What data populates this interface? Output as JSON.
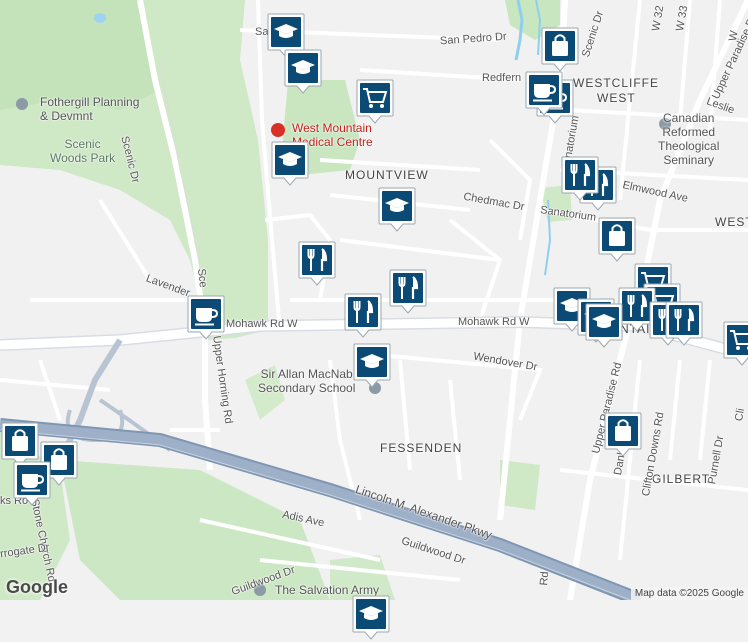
{
  "map": {
    "attribution": "Map data ©2025 Google",
    "logo": "Google",
    "neighbourhoods": [
      {
        "id": "mountview",
        "text": "MOUNTVIEW"
      },
      {
        "id": "westcliffe-west-1",
        "text": "WESTCLIFFE"
      },
      {
        "id": "westcliffe-west-2",
        "text": "WEST"
      },
      {
        "id": "fessenden",
        "text": "FESSENDEN"
      },
      {
        "id": "gilbert",
        "text": "GILBERT"
      },
      {
        "id": "west-edge",
        "text": "WEST"
      },
      {
        "id": "mountain-edge",
        "text": "OUNTAI"
      }
    ],
    "roads": [
      {
        "id": "mohawk-w",
        "text": "Mohawk Rd W"
      },
      {
        "id": "mohawk-e",
        "text": "Mohawk Rd W"
      },
      {
        "id": "scenic-dr",
        "text": "Scenic Dr"
      },
      {
        "id": "scenic-dr-2",
        "text": "Sce"
      },
      {
        "id": "scenic-dr-ne",
        "text": "Scenic Dr"
      },
      {
        "id": "san-pedro",
        "text": "San Pedro Dr"
      },
      {
        "id": "san-top",
        "text": "Sa"
      },
      {
        "id": "redfern",
        "text": "Redfern"
      },
      {
        "id": "chedmac",
        "text": "Chedmac Dr"
      },
      {
        "id": "sanatorium",
        "text": "Sanatorium"
      },
      {
        "id": "sanatorium-2",
        "text": "Sanatorium"
      },
      {
        "id": "elmwood",
        "text": "Elmwood Ave"
      },
      {
        "id": "wendover",
        "text": "Wendover Dr"
      },
      {
        "id": "upper-paradise",
        "text": "Upper Paradise Rd"
      },
      {
        "id": "upper-paradise-ne",
        "text": "Upper Paradise Rd"
      },
      {
        "id": "upper-horning",
        "text": "Upper Horning Rd"
      },
      {
        "id": "lavender",
        "text": "Lavender"
      },
      {
        "id": "lincoln",
        "text": "Lincoln M. Alexander Pkwy"
      },
      {
        "id": "adis",
        "text": "Adis Ave"
      },
      {
        "id": "guildwood",
        "text": "Guildwood Dr"
      },
      {
        "id": "guildwood-2",
        "text": "Guildwood Dr"
      },
      {
        "id": "clifton-downs",
        "text": "Clifton Downs Rd"
      },
      {
        "id": "purnell",
        "text": "Purnell Dr"
      },
      {
        "id": "danl",
        "text": "Danl"
      },
      {
        "id": "w32",
        "text": "W 32"
      },
      {
        "id": "w33",
        "text": "W 33"
      },
      {
        "id": "leslie",
        "text": "Leslie"
      },
      {
        "id": "stone-church",
        "text": "Stone Church Rd"
      },
      {
        "id": "rogate",
        "text": "rrogate Dr"
      },
      {
        "id": "ks-ro",
        "text": "ks Ro"
      },
      {
        "id": "rd-bottom",
        "text": "Rd"
      },
      {
        "id": "cli",
        "text": "Cli"
      },
      {
        "id": "w-edge",
        "text": "W"
      }
    ],
    "places": [
      {
        "id": "fothergill",
        "text": "Fothergill Planning\n& Devmnt"
      },
      {
        "id": "scenic-woods",
        "text": "Scenic\nWoods Park"
      },
      {
        "id": "west-mountain",
        "text": "West Mountain\nMedical Centre"
      },
      {
        "id": "sir-allan",
        "text": "Sir Allan MacNab\nSecondary School"
      },
      {
        "id": "canadian-reformed",
        "text": "Canadian\nReformed\nTheological\nSeminary"
      },
      {
        "id": "salvation-army",
        "text": "The Salvation Army"
      }
    ],
    "markers": [
      {
        "type": "school",
        "icon": "graduation-cap-icon"
      },
      {
        "type": "school",
        "icon": "graduation-cap-icon"
      },
      {
        "type": "shop",
        "icon": "shopping-bag-icon"
      },
      {
        "type": "grocery",
        "icon": "shopping-cart-icon"
      },
      {
        "type": "cafe",
        "icon": "coffee-cup-icon"
      },
      {
        "type": "cafe",
        "icon": "coffee-cup-icon"
      },
      {
        "type": "school",
        "icon": "graduation-cap-icon"
      },
      {
        "type": "school",
        "icon": "graduation-cap-icon"
      },
      {
        "type": "restaurant",
        "icon": "fork-knife-icon"
      },
      {
        "type": "school",
        "icon": "graduation-cap-icon"
      },
      {
        "type": "restaurant",
        "icon": "fork-knife-icon"
      },
      {
        "type": "restaurant",
        "icon": "fork-knife-icon"
      },
      {
        "type": "shop",
        "icon": "shopping-bag-icon"
      },
      {
        "type": "restaurant",
        "icon": "fork-knife-icon"
      },
      {
        "type": "cafe",
        "icon": "coffee-cup-icon"
      },
      {
        "type": "restaurant",
        "icon": "fork-knife-icon"
      },
      {
        "type": "school",
        "icon": "graduation-cap-icon"
      },
      {
        "type": "school",
        "icon": "graduation-cap-icon"
      },
      {
        "type": "grocery",
        "icon": "shopping-cart-icon"
      },
      {
        "type": "grocery",
        "icon": "shopping-cart-icon"
      },
      {
        "type": "restaurant",
        "icon": "fork-knife-icon"
      },
      {
        "type": "restaurant",
        "icon": "fork-knife-icon"
      },
      {
        "type": "restaurant",
        "icon": "fork-knife-icon"
      },
      {
        "type": "grocery",
        "icon": "shopping-cart-icon"
      },
      {
        "type": "school",
        "icon": "graduation-cap-icon"
      },
      {
        "type": "shop",
        "icon": "shopping-bag-icon"
      },
      {
        "type": "shop",
        "icon": "shopping-bag-icon"
      },
      {
        "type": "shop",
        "icon": "shopping-bag-icon"
      },
      {
        "type": "cafe",
        "icon": "coffee-cup-icon"
      },
      {
        "type": "school",
        "icon": "graduation-cap-icon"
      }
    ],
    "colors": {
      "marker_fill": "#0b4a75",
      "marker_border": "#ffffff",
      "park": "#c8e6c0",
      "highway": "#8fa3bd",
      "major_road": "#ffffff",
      "water": "#8ecff0",
      "background": "#f2f2f2"
    }
  }
}
